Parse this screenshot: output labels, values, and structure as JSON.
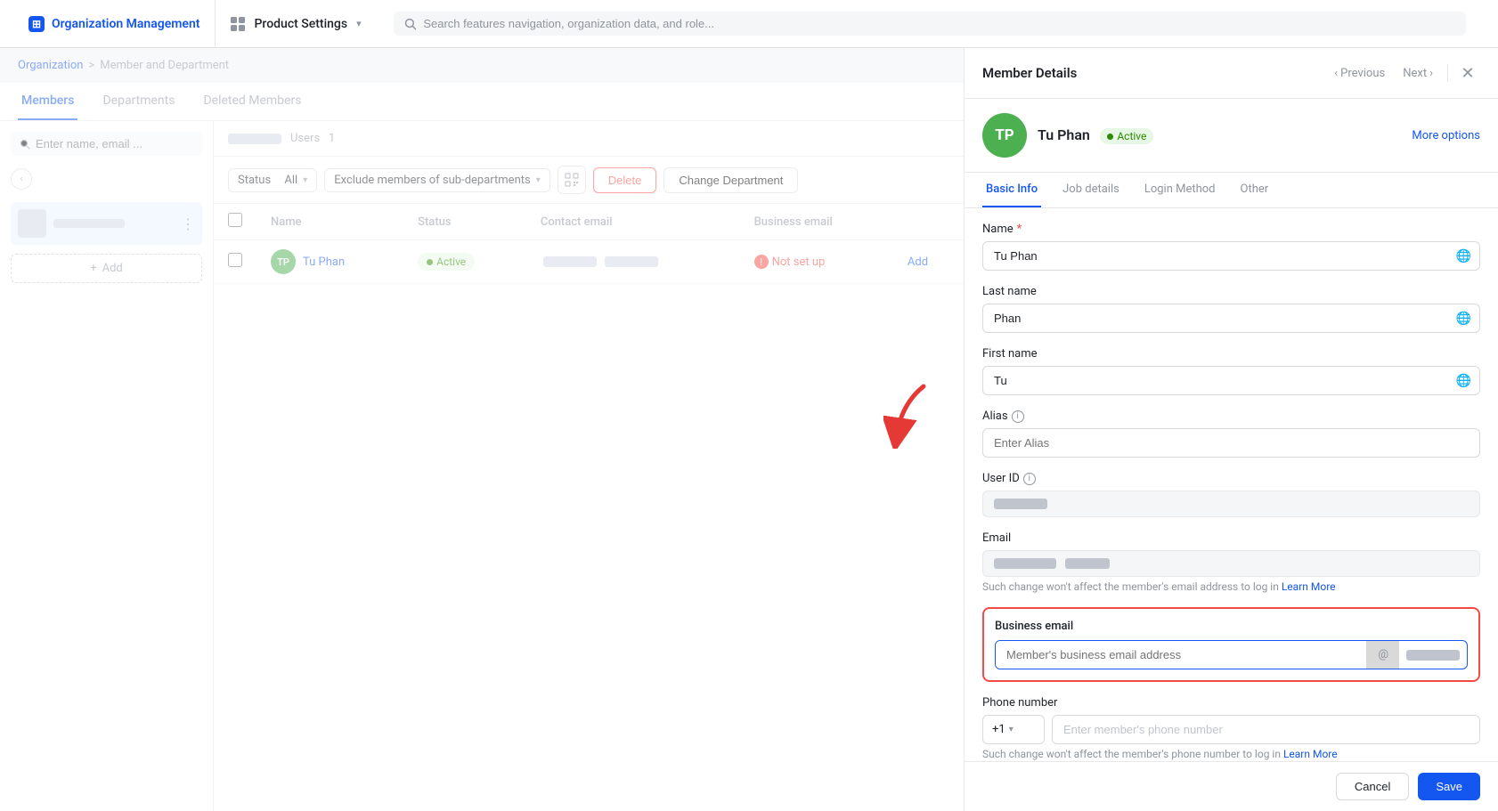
{
  "topbar": {
    "app_name": "Organization Management",
    "product_name": "Product Settings",
    "product_dropdown": "▾",
    "search_placeholder": "Search features navigation, organization data, and role..."
  },
  "breadcrumb": {
    "root": "Organization",
    "separator": ">",
    "current": "Member and Department"
  },
  "tabs": {
    "items": [
      {
        "id": "members",
        "label": "Members",
        "active": true
      },
      {
        "id": "departments",
        "label": "Departments",
        "active": false
      },
      {
        "id": "deleted",
        "label": "Deleted Members",
        "active": false
      }
    ]
  },
  "dept_search_placeholder": "Enter name, email ...",
  "dept_users_label": "Users",
  "dept_users_count": "1",
  "filter": {
    "status_label": "Status",
    "status_value": "All",
    "exclude_label": "Exclude members of sub-departments",
    "delete_btn": "Delete",
    "change_dept_btn": "Change Department"
  },
  "table": {
    "columns": [
      "",
      "Name",
      "Status",
      "Contact email",
      "Business email",
      ""
    ],
    "rows": [
      {
        "id": 1,
        "avatar_initials": "TP",
        "avatar_color": "#4caf50",
        "name": "Tu Phan",
        "status": "Active",
        "contact_email_blurred": true,
        "business_email_not_setup": true,
        "business_email_label": "Not set up",
        "add_label": "Add"
      }
    ]
  },
  "panel": {
    "title": "Member Details",
    "nav": {
      "prev_label": "Previous",
      "next_label": "Next"
    },
    "member": {
      "avatar_initials": "TP",
      "avatar_color": "#4caf50",
      "name": "Tu Phan",
      "status": "Active",
      "more_options": "More options"
    },
    "detail_tabs": [
      {
        "id": "basic-info",
        "label": "Basic Info",
        "active": true
      },
      {
        "id": "job-details",
        "label": "Job details",
        "active": false
      },
      {
        "id": "login-method",
        "label": "Login Method",
        "active": false
      },
      {
        "id": "other",
        "label": "Other",
        "active": false
      }
    ],
    "form": {
      "name_label": "Name",
      "name_required": "*",
      "name_value": "Tu Phan",
      "last_name_label": "Last name",
      "last_name_value": "Phan",
      "first_name_label": "First name",
      "first_name_value": "Tu",
      "alias_label": "Alias",
      "alias_placeholder": "Enter Alias",
      "user_id_label": "User ID",
      "email_label": "Email",
      "email_note": "Such change won't affect the member's email address to log in",
      "email_learn_more": "Learn More",
      "business_email_label": "Business email",
      "business_email_placeholder": "Member's business email address",
      "business_email_at": "@",
      "phone_label": "Phone number",
      "phone_country_code": "+1",
      "phone_placeholder": "Enter member's phone number",
      "phone_note": "Such change won't affect the member's phone number to log in",
      "phone_learn_more": "Learn More"
    },
    "footer": {
      "cancel_label": "Cancel",
      "save_label": "Save"
    }
  }
}
